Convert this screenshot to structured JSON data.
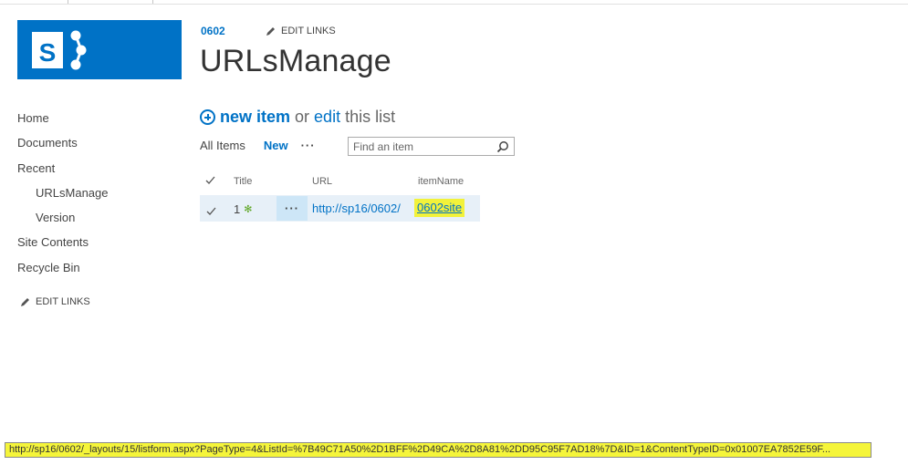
{
  "site": {
    "link": "0602",
    "edit_links": "EDIT LINKS"
  },
  "page": {
    "title": "URLsManage"
  },
  "nav": {
    "items": [
      {
        "label": "Home"
      },
      {
        "label": "Documents"
      },
      {
        "label": "Recent"
      },
      {
        "label": "URLsManage"
      },
      {
        "label": "Version"
      },
      {
        "label": "Site Contents"
      },
      {
        "label": "Recycle Bin"
      }
    ],
    "edit_links": "EDIT LINKS"
  },
  "toolbar": {
    "new_item": "new item",
    "or": "or",
    "edit": "edit",
    "this_list": "this list"
  },
  "views": {
    "all_items": "All Items",
    "new": "New",
    "more": "···"
  },
  "search": {
    "placeholder": "Find an item",
    "icon": "search-icon"
  },
  "list": {
    "columns": {
      "title": "Title",
      "url": "URL",
      "itemname": "itemName"
    },
    "rows": [
      {
        "title": "1",
        "new_badge": "✻",
        "url": "http://sp16/0602/",
        "itemname": "0602site",
        "more": "···"
      }
    ]
  },
  "status": {
    "url": "http://sp16/0602/_layouts/15/listform.aspx?PageType=4&ListId=%7B49C71A50%2D1BFF%2D49CA%2D8A81%2DD95C95F7AD18%7D&ID=1&ContentTypeID=0x01007EA7852E59F..."
  },
  "colors": {
    "accent": "#0072c6",
    "highlight": "#f2f23a",
    "row_bg": "#e7f0f8"
  }
}
